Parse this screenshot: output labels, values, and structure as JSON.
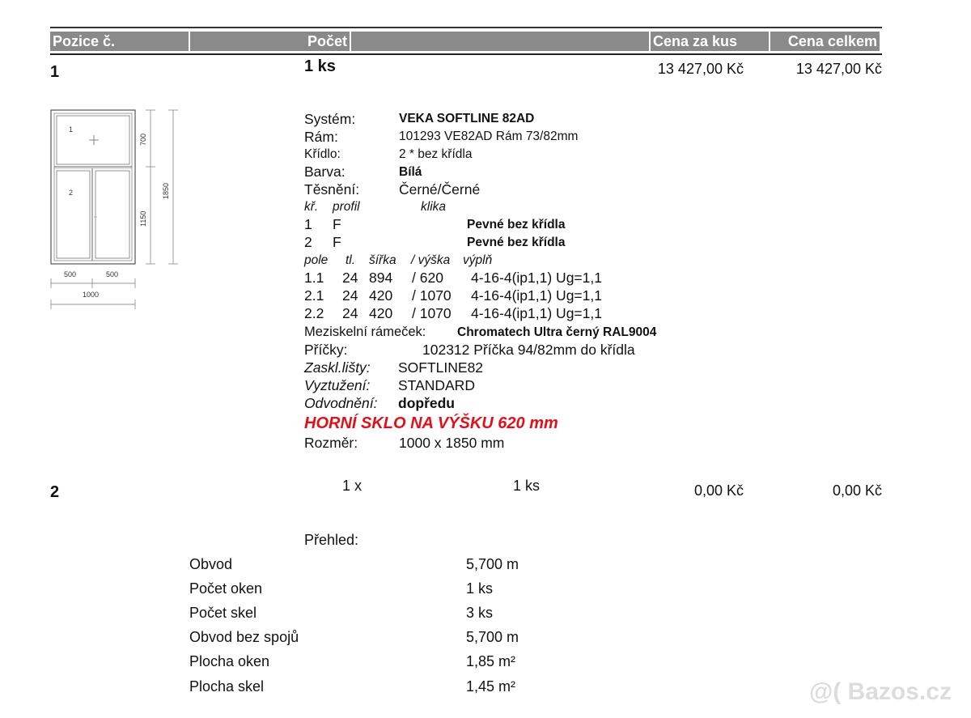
{
  "header": {
    "col_position": "Pozice č.",
    "col_count": "Počet",
    "col_unit_price": "Cena za kus",
    "col_total_price": "Cena celkem"
  },
  "item1": {
    "position": "1",
    "count": "1 ks",
    "unit_price": "13 427,00 Kč",
    "total_price": "13 427,00 Kč",
    "drawing": {
      "field_1": "1",
      "field_2": "2",
      "dim_top": "700",
      "dim_bottom": "1150",
      "dim_total_height": "1850",
      "dim_left_width": "500",
      "dim_right_width": "500",
      "dim_total_width": "1000"
    },
    "system_label": "Systém:",
    "system_value": "VEKA SOFTLINE 82AD",
    "frame_label": "Rám:",
    "frame_value": "101293 VE82AD Rám 73/82mm",
    "sash_label": "Křídlo:",
    "sash_value": "2 * bez křídla",
    "color_label": "Barva:",
    "color_value": "Bílá",
    "seal_label": "Těsnění:",
    "seal_value": "Černé/Černé",
    "sash_header_kr": "kř.",
    "sash_header_profil": "profil",
    "sash_header_klika": "klika",
    "sash_rows": [
      {
        "kr": "1",
        "profil": "F",
        "klika": "Pevné bez křídla"
      },
      {
        "kr": "2",
        "profil": "F",
        "klika": "Pevné bez křídla"
      }
    ],
    "field_header": {
      "pole": "pole",
      "tl": "tl.",
      "sirka": "šířka",
      "vyska": "/ výška",
      "vypln": "výplň"
    },
    "fields": [
      {
        "pole": "1.1",
        "tl": "24",
        "sirka": "894",
        "vyska": "/ 620",
        "vypln": "4-16-4(ip1,1) Ug=1,1"
      },
      {
        "pole": "2.1",
        "tl": "24",
        "sirka": "420",
        "vyska": "/ 1070",
        "vypln": "4-16-4(ip1,1) Ug=1,1"
      },
      {
        "pole": "2.2",
        "tl": "24",
        "sirka": "420",
        "vyska": "/ 1070",
        "vypln": "4-16-4(ip1,1) Ug=1,1"
      }
    ],
    "spacer_label": "Meziskelní rámeček:",
    "spacer_value": "Chromatech Ultra černý RAL9004",
    "mullion_label": "Příčky:",
    "mullion_value": "102312 Příčka 94/82mm do křídla",
    "bead_label": "Zaskl.lišty:",
    "bead_value": "SOFTLINE82",
    "reinf_label": "Vyztužení:",
    "reinf_value": "STANDARD",
    "drain_label": "Odvodnění:",
    "drain_value": "dopředu",
    "note": "HORNÍ SKLO NA VÝŠKU 620 mm",
    "size_label": "Rozměr:",
    "size_value": "1000 x  1850 mm"
  },
  "item2": {
    "position": "2",
    "qty_x": "1  x",
    "count": "1 ks",
    "unit_price": "0,00 Kč",
    "total_price": "0,00 Kč"
  },
  "summary": {
    "title": "Přehled:",
    "rows": [
      {
        "label": "Obvod",
        "value": "5,700 m"
      },
      {
        "label": "Počet oken",
        "value": "1 ks"
      },
      {
        "label": "Počet skel",
        "value": "3 ks"
      },
      {
        "label": "Obvod bez spojů",
        "value": "5,700 m"
      },
      {
        "label": "Plocha oken",
        "value": "1,85 m²"
      },
      {
        "label": "Plocha skel",
        "value": "1,45 m²"
      }
    ]
  },
  "watermark": "@( Bazos.cz"
}
